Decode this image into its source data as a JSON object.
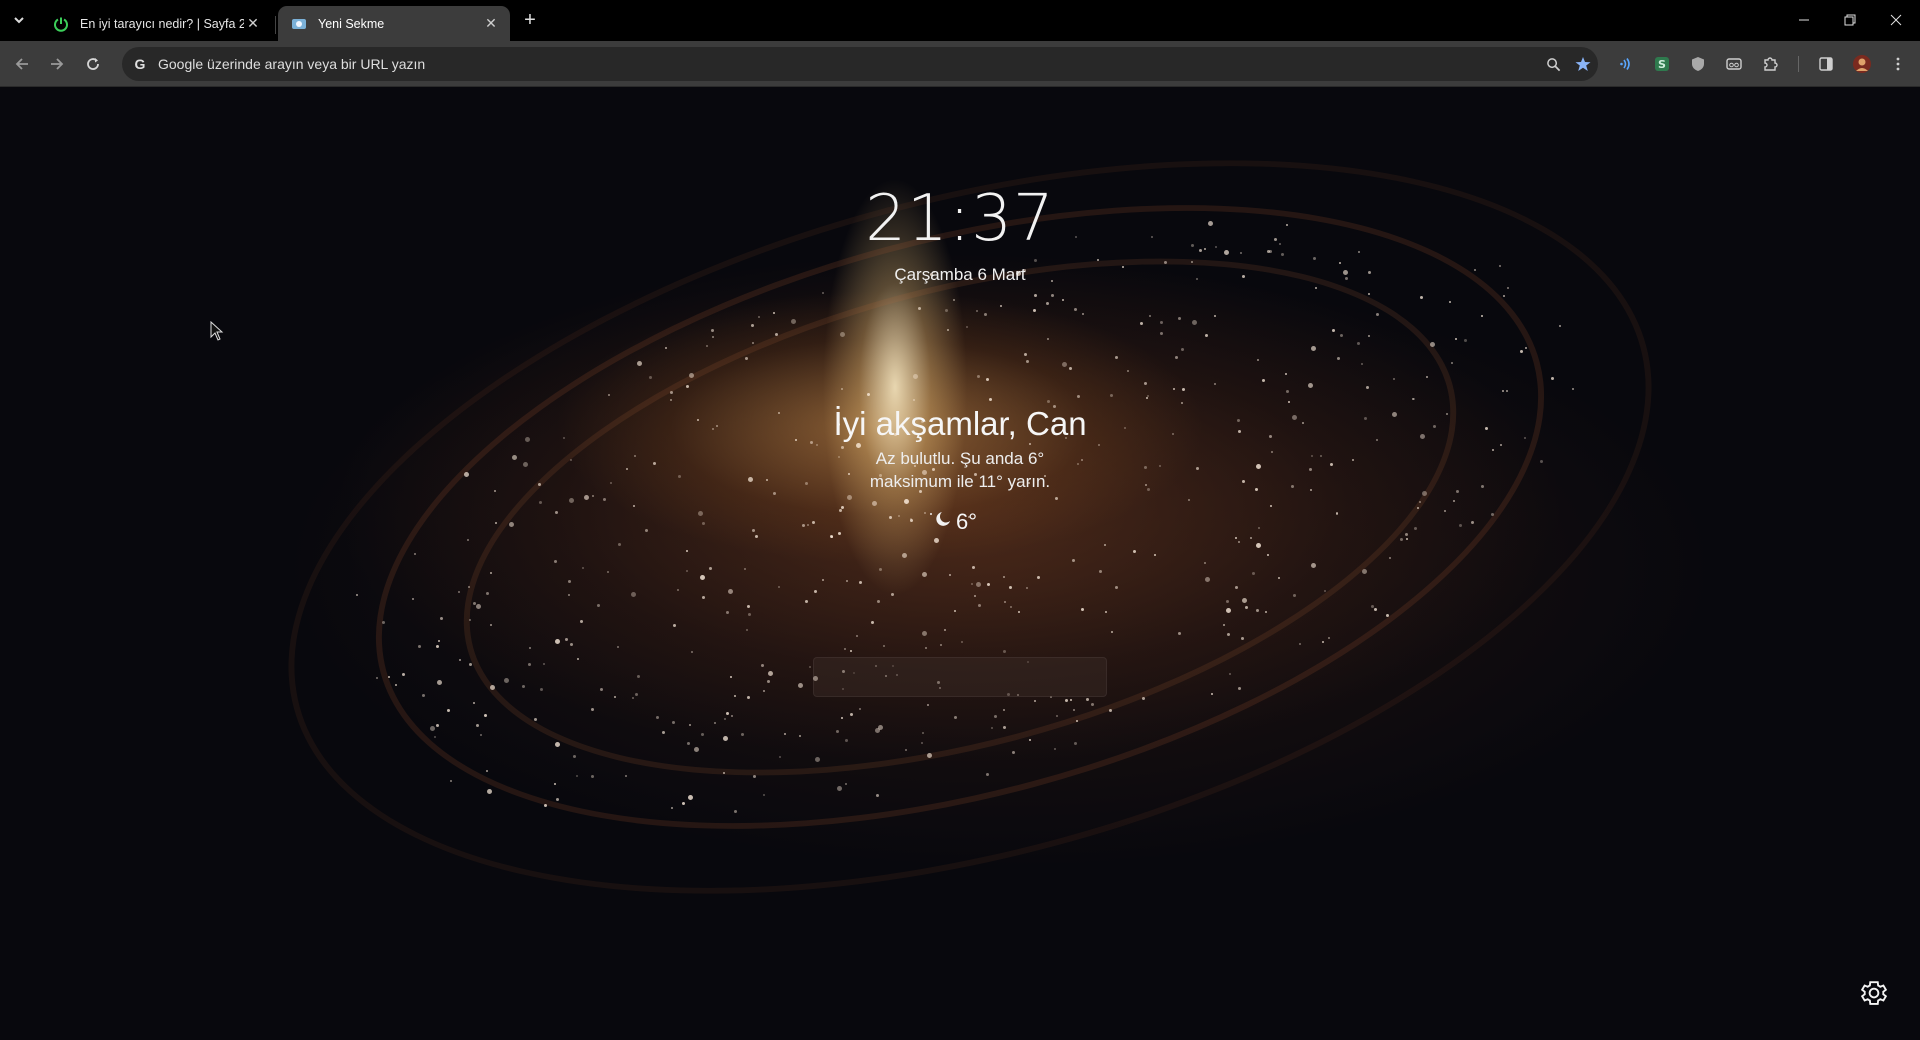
{
  "tabs": [
    {
      "title": "En iyi tarayıcı nedir? | Sayfa 2 |",
      "icon": "power-icon",
      "active": false
    },
    {
      "title": "Yeni Sekme",
      "icon": "newtab-favicon-icon",
      "active": true
    }
  ],
  "omnibox": {
    "placeholder": "Google üzerinde arayın veya bir URL yazın",
    "value": ""
  },
  "ntp": {
    "time": "21:37",
    "date": "Çarşamba 6 Mart",
    "greeting": "İyi akşamlar, Can",
    "weather_line1": "Az bulutlu. Şu anda 6°",
    "weather_line2": "maksimum ile 11° yarın.",
    "weather_temp": "6°",
    "search_placeholder": ""
  },
  "colors": {
    "accent_extension": "#5aa7ff",
    "tab_active_bg": "#3c3c3c",
    "toolbar_bg": "#3c3c3c",
    "omnibox_bg": "#282828"
  }
}
